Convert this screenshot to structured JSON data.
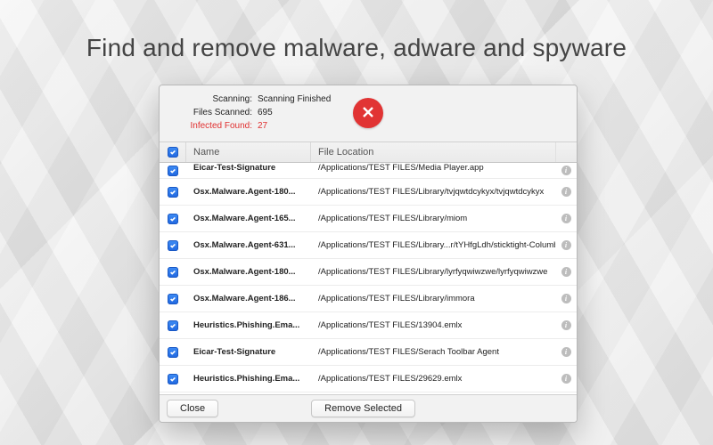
{
  "headline": "Find and remove malware, adware and spyware",
  "summary": {
    "scanning_label": "Scanning:",
    "scanning_value": "Scanning Finished",
    "files_label": "Files Scanned:",
    "files_value": "695",
    "infected_label": "Infected Found:",
    "infected_value": "27"
  },
  "columns": {
    "name": "Name",
    "location": "File Location"
  },
  "rows": [
    {
      "name": "Eicar-Test-Signature",
      "location": "/Applications/TEST FILES/Media Player.app"
    },
    {
      "name": "Osx.Malware.Agent-180...",
      "location": "/Applications/TEST FILES/Library/tvjqwtdcykyx/tvjqwtdcykyx"
    },
    {
      "name": "Osx.Malware.Agent-165...",
      "location": "/Applications/TEST FILES/Library/miom"
    },
    {
      "name": "Osx.Malware.Agent-631...",
      "location": "/Applications/TEST FILES/Library...r/tYHfgLdh/sticktight-Columbine"
    },
    {
      "name": "Osx.Malware.Agent-180...",
      "location": "/Applications/TEST FILES/Library/lyrfyqwiwzwe/lyrfyqwiwzwe"
    },
    {
      "name": "Osx.Malware.Agent-186...",
      "location": "/Applications/TEST FILES/Library/immora"
    },
    {
      "name": "Heuristics.Phishing.Ema...",
      "location": "/Applications/TEST FILES/13904.emlx"
    },
    {
      "name": "Eicar-Test-Signature",
      "location": "/Applications/TEST FILES/Serach Toolbar Agent"
    },
    {
      "name": "Heuristics.Phishing.Ema...",
      "location": "/Applications/TEST FILES/29629.emlx"
    }
  ],
  "buttons": {
    "close": "Close",
    "remove": "Remove Selected"
  }
}
